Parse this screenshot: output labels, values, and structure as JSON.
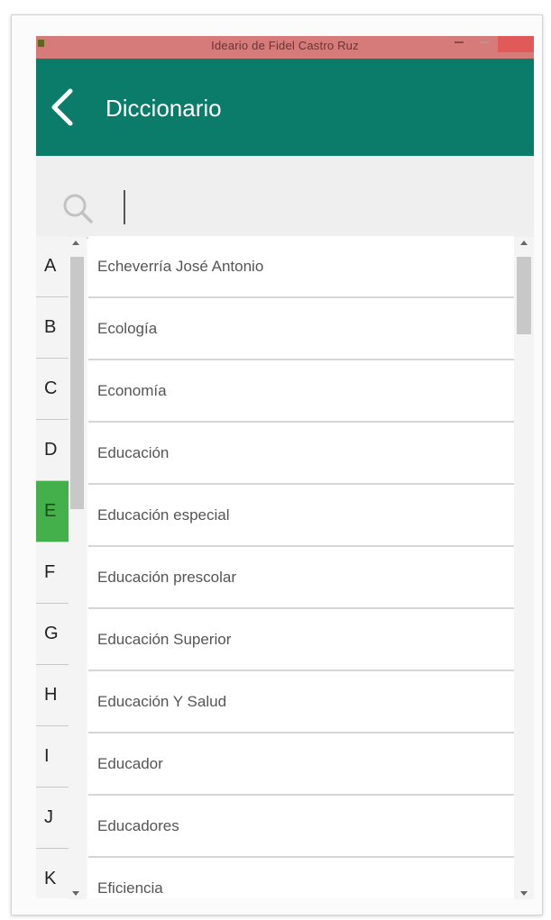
{
  "window": {
    "title": "Ideario de Fidel Castro Ruz"
  },
  "appbar": {
    "title": "Diccionario"
  },
  "search": {
    "value": "",
    "placeholder": ""
  },
  "alphabet": {
    "active": "E",
    "items": [
      "A",
      "B",
      "C",
      "D",
      "E",
      "F",
      "G",
      "H",
      "I",
      "J",
      "K"
    ]
  },
  "list": {
    "items": [
      "Echeverría José Antonio",
      "Ecología",
      "Economía",
      "Educación",
      "Educación especial",
      "Educación prescolar",
      "Educación Superior",
      "Educación Y Salud",
      "Educador",
      "Educadores",
      "Eficiencia"
    ]
  },
  "colors": {
    "appbar": "#0b7c6a",
    "active_letter": "#44b04b",
    "titlebar": "#d77a7a"
  },
  "icons": {
    "back": "chevron-left-icon",
    "search": "search-icon"
  }
}
